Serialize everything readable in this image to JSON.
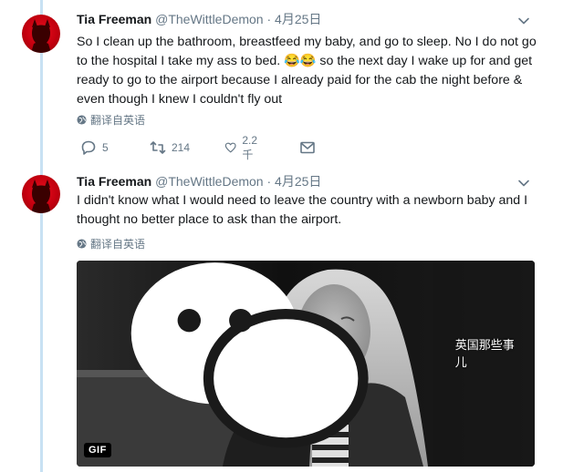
{
  "tweets": [
    {
      "name": "Tia Freeman",
      "handle": "@TheWittleDemon",
      "separator": "·",
      "date": "4月25日",
      "text": "So I clean up the bathroom, breastfeed my baby, and go to sleep. No I do not go to the hospital I take my ass to bed. 😂😂 so the next day I wake up for and get ready to go to the airport because I already paid for the cab the night before & even though I knew I couldn't fly out",
      "translate": "翻译自英语",
      "replies": "5",
      "retweets": "214",
      "likes": "2.2千"
    },
    {
      "name": "Tia Freeman",
      "handle": "@TheWittleDemon",
      "separator": "·",
      "date": "4月25日",
      "text": "I didn't know what I would need to leave the country with a newborn baby and I thought no better place to ask than the airport.",
      "translate": "翻译自英语",
      "gif_label": "GIF"
    }
  ],
  "watermark": "英国那些事儿",
  "colors": {
    "thread_line": "#c8e1f3",
    "muted": "#657786",
    "text": "#14171a",
    "avatar": "#c4000f"
  }
}
